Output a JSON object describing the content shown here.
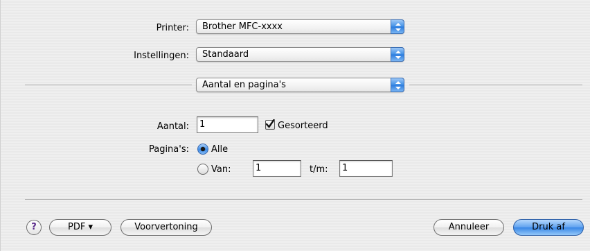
{
  "printer": {
    "label": "Printer:",
    "value": "Brother MFC-xxxx"
  },
  "settings": {
    "label": "Instellingen:",
    "value": "Standaard"
  },
  "panel": {
    "value": "Aantal en pagina's"
  },
  "copies": {
    "label": "Aantal:",
    "value": "1",
    "collate_label": "Gesorteerd",
    "collate_checked": true
  },
  "pages": {
    "label": "Pagina's:",
    "all_label": "Alle",
    "from_label": "Van:",
    "from_value": "1",
    "to_label": "t/m:",
    "to_value": "1",
    "selected": "all"
  },
  "buttons": {
    "help": "?",
    "pdf": "PDF ▾",
    "preview": "Voorvertoning",
    "cancel": "Annuleer",
    "print": "Druk af"
  },
  "colors": {
    "accent": "#3886e6",
    "help_purple": "#5a2a8a"
  }
}
